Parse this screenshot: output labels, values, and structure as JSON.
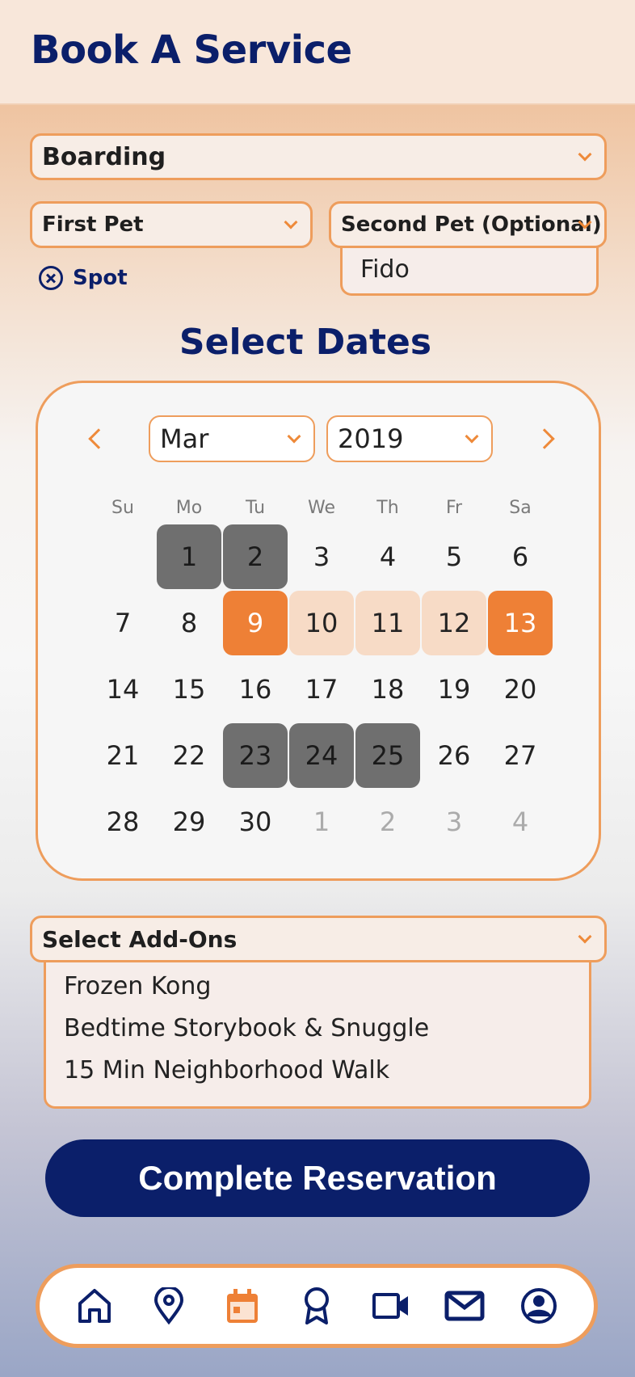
{
  "header": {
    "title": "Book A Service"
  },
  "service_select": {
    "value": "Boarding"
  },
  "first_pet_select": {
    "value": "First Pet"
  },
  "second_pet_select": {
    "value": "Second Pet (Optional)",
    "options": [
      "Fido"
    ]
  },
  "selected_pet_chip": {
    "label": "Spot",
    "icon": "close-circle-icon"
  },
  "dates": {
    "title": "Select Dates",
    "month_select": "Mar",
    "year_select": "2019",
    "weekdays": [
      "Su",
      "Mo",
      "Tu",
      "We",
      "Th",
      "Fr",
      "Sa"
    ],
    "weeks": [
      [
        "",
        "1",
        "2",
        "3",
        "4",
        "5",
        "6"
      ],
      [
        "7",
        "8",
        "9",
        "10",
        "11",
        "12",
        "13"
      ],
      [
        "14",
        "15",
        "16",
        "17",
        "18",
        "19",
        "20"
      ],
      [
        "21",
        "22",
        "23",
        "24",
        "25",
        "26",
        "27"
      ],
      [
        "28",
        "29",
        "30",
        "1",
        "2",
        "3",
        "4"
      ]
    ],
    "booked_days": [
      "1",
      "2",
      "23",
      "24",
      "25"
    ],
    "selected_start": "9",
    "selected_end": "13",
    "selected_range": [
      "10",
      "11",
      "12"
    ],
    "next_month_days": [
      "1",
      "2",
      "3",
      "4"
    ]
  },
  "addons": {
    "placeholder": "Select Add-Ons",
    "items": [
      "Frozen Kong",
      "Bedtime Storybook & Snuggle",
      "15 Min Neighborhood Walk"
    ]
  },
  "cta": {
    "label": "Complete Reservation"
  },
  "tabbar": {
    "items": [
      {
        "icon": "home-icon",
        "active": false
      },
      {
        "icon": "location-pin-icon",
        "active": false
      },
      {
        "icon": "calendar-icon",
        "active": true
      },
      {
        "icon": "award-ribbon-icon",
        "active": false
      },
      {
        "icon": "video-camera-icon",
        "active": false
      },
      {
        "icon": "mail-icon",
        "active": false
      },
      {
        "icon": "user-profile-icon",
        "active": false
      }
    ]
  },
  "colors": {
    "navy": "#0b1f6a",
    "orange": "#ee8036",
    "orange_border": "#ee9d5c",
    "booked_gray": "#6f6f6f"
  }
}
